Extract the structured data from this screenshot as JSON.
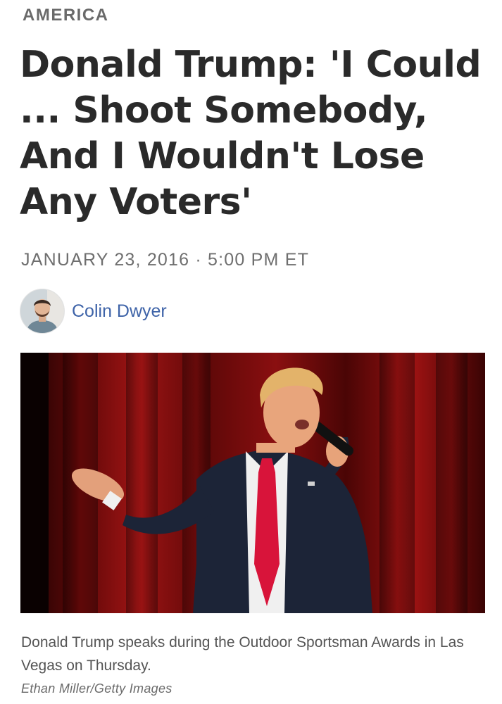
{
  "section": {
    "label": "AMERICA"
  },
  "article": {
    "headline": "Donald Trump: 'I Could ... Shoot Somebody, And I Wouldn't Lose Any Voters'",
    "dateline": "JANUARY 23, 2016 · 5:00 PM ET",
    "author": {
      "name": "Colin Dwyer",
      "avatar_icon": "author-avatar"
    },
    "image": {
      "caption": "Donald Trump speaks during the Outdoor Sportsman Awards in Las Vegas on Thursday.",
      "credit": "Ethan Miller/Getty Images"
    }
  },
  "colors": {
    "link": "#3e63a8",
    "headline": "#2a2a2a",
    "meta": "#6f6f6f",
    "curtain_red": "#8a0f10"
  }
}
